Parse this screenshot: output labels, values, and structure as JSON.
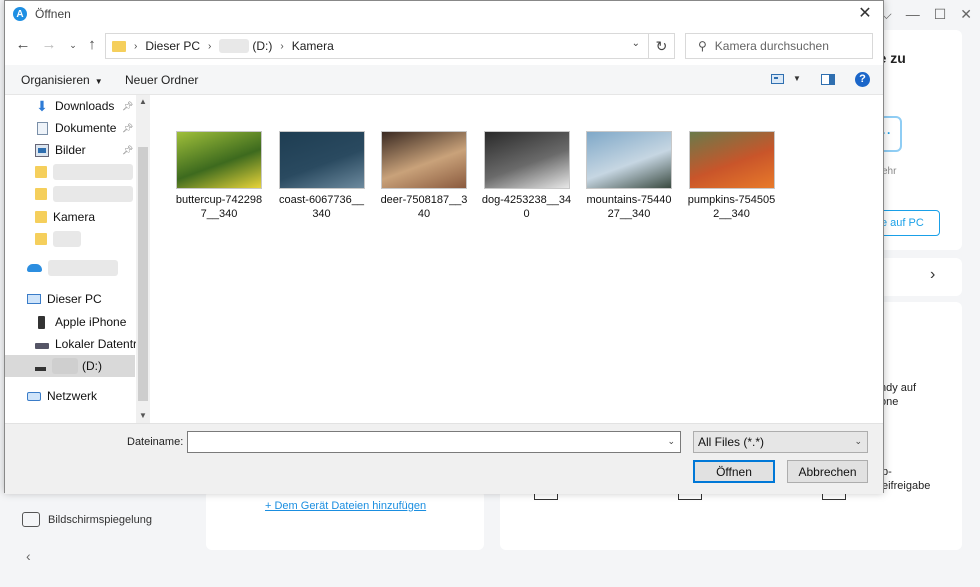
{
  "dialog": {
    "title": "Öffnen",
    "app_logo_letter": "A"
  },
  "nav": {
    "breadcrumb": [
      "Dieser PC",
      "(D:)",
      "Kamera"
    ],
    "search_placeholder": "Kamera durchsuchen"
  },
  "toolbar": {
    "organize_label": "Organisieren",
    "new_folder_label": "Neuer Ordner",
    "help_label": "?"
  },
  "sidebar": {
    "items": [
      {
        "label": "Downloads",
        "icon": "download-icon",
        "pinned": true
      },
      {
        "label": "Dokumente",
        "icon": "document-icon",
        "pinned": true
      },
      {
        "label": "Bilder",
        "icon": "pictures-icon",
        "pinned": true
      },
      {
        "label": "",
        "icon": "folder-icon",
        "blurred": true
      },
      {
        "label": "",
        "icon": "folder-icon",
        "blurred": true
      },
      {
        "label": "Kamera",
        "icon": "folder-icon"
      },
      {
        "label": "",
        "icon": "folder-icon",
        "blurred": true
      },
      {
        "label": "",
        "icon": "cloud-icon",
        "blurred": true
      },
      {
        "label": "Dieser PC",
        "icon": "computer-icon"
      },
      {
        "label": "Apple iPhone",
        "icon": "phone-icon"
      },
      {
        "label": "Lokaler Datenträ",
        "icon": "drive-icon"
      },
      {
        "label": "(D:)",
        "icon": "drive-icon",
        "selected": true
      },
      {
        "label": "Netzwerk",
        "icon": "network-icon"
      }
    ]
  },
  "files": [
    {
      "name": "buttercup-7422987__340",
      "colors": [
        "#9fbf3a",
        "#e8d43a",
        "#3d6a1e"
      ]
    },
    {
      "name": "coast-6067736__340",
      "colors": [
        "#1e3d52",
        "#6d8a9e",
        "#2a4a60"
      ]
    },
    {
      "name": "deer-7508187__340",
      "colors": [
        "#3a2a22",
        "#8a5a3e",
        "#c9a27a"
      ]
    },
    {
      "name": "dog-4253238__340",
      "colors": [
        "#2a2a2a",
        "#e8e8e8",
        "#6a6a6a"
      ]
    },
    {
      "name": "mountains-7544027__340",
      "colors": [
        "#7fa8c8",
        "#3a4a40",
        "#c6d6e2"
      ]
    },
    {
      "name": "pumpkins-7545052__340",
      "colors": [
        "#6a7a4a",
        "#e87a2a",
        "#c9552a"
      ]
    }
  ],
  "bottom": {
    "filename_label": "Dateiname:",
    "filename_value": "",
    "filetype_value": "All Files (*.*)",
    "open_label": "Öffnen",
    "cancel_label": "Abbrechen"
  },
  "background": {
    "heading_fragment": "ne zu",
    "small_fragment": "ehr",
    "pc_button_fragment": "e auf PC",
    "text_fragment_1": "ndy auf",
    "text_fragment_2": "one",
    "text_fragment_3": "p-",
    "text_fragment_4": "eifreigabe",
    "add_files_link": "+ Dem Gerät Dateien hinzufügen",
    "mirror_label": "Bildschirmspiegelung"
  }
}
